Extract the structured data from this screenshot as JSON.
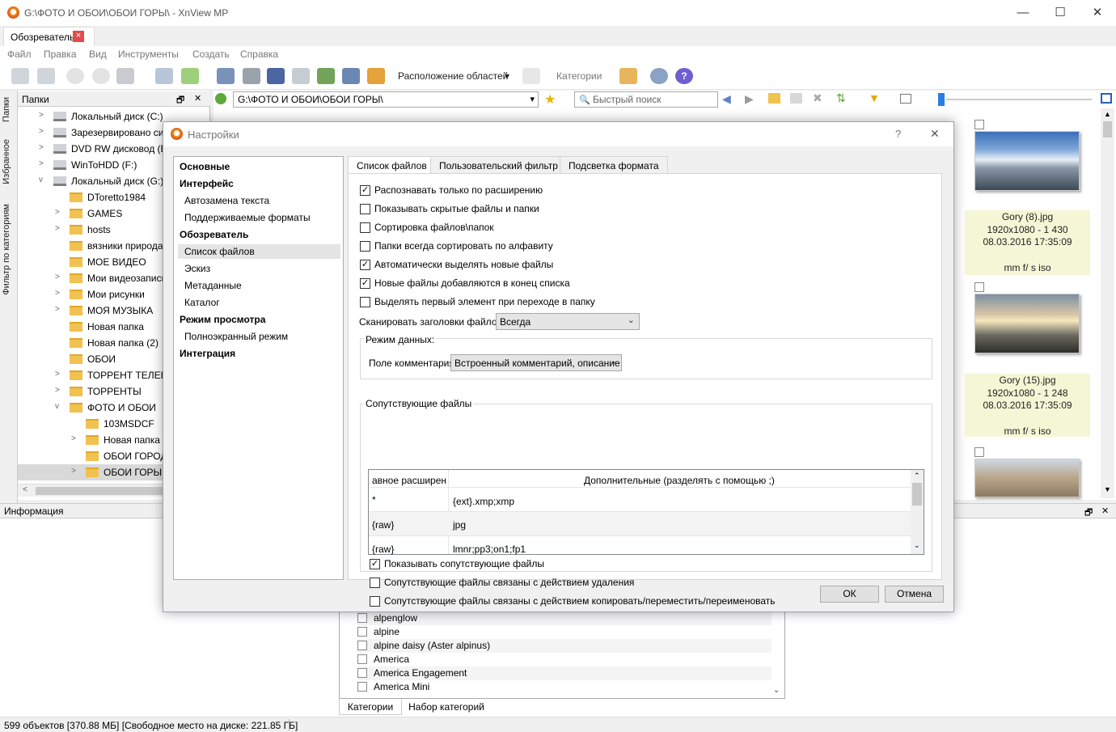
{
  "window": {
    "title": "G:\\ФОТО И ОБОИ\\ОБОИ ГОРЫ\\ - XnView MP",
    "min": "—",
    "max": "☐",
    "close": "✕"
  },
  "tab": {
    "label": "Обозреватель",
    "close": "×"
  },
  "menu": [
    "Файл",
    "Правка",
    "Вид",
    "Инструменты",
    "Создать",
    "Справка"
  ],
  "toolbar": {
    "layout_label": "Расположение областей",
    "categories_label": "Категории"
  },
  "sidetabs": [
    "Папки",
    "Избранное",
    "Фильтр по категориям"
  ],
  "folders": {
    "header": "Папки",
    "pin": "🗗",
    "close": "✕",
    "items": [
      {
        "label": "Локальный диск (C:)",
        "kind": "drive",
        "arrow": ">"
      },
      {
        "label": "Зарезервировано си",
        "kind": "drive",
        "arrow": ">"
      },
      {
        "label": "DVD RW дисковод (E:",
        "kind": "drive",
        "arrow": ">"
      },
      {
        "label": "WinToHDD (F:)",
        "kind": "drive",
        "arrow": ">"
      },
      {
        "label": "Локальный диск (G:)",
        "kind": "drive",
        "arrow": "v"
      },
      {
        "label": "DToretto1984",
        "kind": "folder",
        "arrow": ""
      },
      {
        "label": "GAMES",
        "kind": "folder",
        "arrow": ">"
      },
      {
        "label": "hosts",
        "kind": "folder",
        "arrow": ">"
      },
      {
        "label": "вязники природа",
        "kind": "folder",
        "arrow": ""
      },
      {
        "label": "МОЕ ВИДЕО",
        "kind": "folder",
        "arrow": ""
      },
      {
        "label": "Мои видеозаписи",
        "kind": "folder",
        "arrow": ">"
      },
      {
        "label": "Мои рисунки",
        "kind": "folder",
        "arrow": ">"
      },
      {
        "label": "МОЯ МУЗЫКА",
        "kind": "folder",
        "arrow": ">"
      },
      {
        "label": "Новая папка",
        "kind": "folder",
        "arrow": ""
      },
      {
        "label": "Новая папка (2)",
        "kind": "folder",
        "arrow": ""
      },
      {
        "label": "ОБОИ",
        "kind": "folder",
        "arrow": ""
      },
      {
        "label": "ТОРРЕНТ ТЕЛЕВИ",
        "kind": "folder",
        "arrow": ">"
      },
      {
        "label": "ТОРРЕНТЫ",
        "kind": "folder",
        "arrow": ">"
      },
      {
        "label": "ФОТО И ОБОИ",
        "kind": "folder",
        "arrow": "v"
      },
      {
        "label": "103MSDCF",
        "kind": "folder",
        "arrow": "",
        "indent": 1
      },
      {
        "label": "Новая папка",
        "kind": "folder",
        "arrow": ">",
        "indent": 1
      },
      {
        "label": "ОБОИ ГОРОД",
        "kind": "folder",
        "arrow": "",
        "indent": 1
      },
      {
        "label": "ОБОИ ГОРЫ",
        "kind": "folder",
        "arrow": ">",
        "indent": 1,
        "selected": true
      }
    ]
  },
  "address": {
    "path": "G:\\ФОТО И ОБОИ\\ОБОИ ГОРЫ\\",
    "search_placeholder": "Быстрый поиск"
  },
  "thumbs": [
    {
      "name": "Gory (8).jpg",
      "dims": "1920x1080 - 1 430",
      "date": "08.03.2016 17:35:09",
      "exif": "mm f/ s iso"
    },
    {
      "name": "Gory (15).jpg",
      "dims": "1920x1080 - 1 248",
      "date": "08.03.2016 17:35:09",
      "exif": "mm f/ s iso"
    }
  ],
  "info": {
    "header": "Информация",
    "pin": "🗗",
    "close": "✕"
  },
  "categories": {
    "items": [
      "alpenglow",
      "alpine",
      "alpine daisy (Aster alpinus)",
      "America",
      "America Engagement",
      "America Mini"
    ],
    "tabs": [
      "Категории",
      "Набор категорий"
    ]
  },
  "status": "599 объектов [370.88 МБ] [Свободное место на диске: 221.85 ГБ]",
  "dialog": {
    "title": "Настройки",
    "help": "?",
    "close": "✕",
    "nav": [
      {
        "label": "Основные",
        "bold": true
      },
      {
        "label": "Интерфейс",
        "bold": true
      },
      {
        "label": "Автозамена текста"
      },
      {
        "label": "Поддерживаемые форматы"
      },
      {
        "label": "Обозреватель",
        "bold": true
      },
      {
        "label": "Список файлов",
        "selected": true
      },
      {
        "label": "Эскиз"
      },
      {
        "label": "Метаданные"
      },
      {
        "label": "Каталог"
      },
      {
        "label": "Режим просмотра",
        "bold": true
      },
      {
        "label": "Полноэкранный режим"
      },
      {
        "label": "Интеграция",
        "bold": true
      }
    ],
    "tabs": [
      "Список файлов",
      "Пользовательский фильтр",
      "Подсветка формата"
    ],
    "options": [
      {
        "label": "Распознавать только по расширению",
        "checked": true
      },
      {
        "label": "Показывать скрытые файлы и папки",
        "checked": false
      },
      {
        "label": "Сортировка файлов\\папок",
        "checked": false
      },
      {
        "label": "Папки всегда сортировать по алфавиту",
        "checked": false
      },
      {
        "label": "Автоматически выделять новые файлы",
        "checked": true
      },
      {
        "label": "Новые файлы добавляются в конец списка",
        "checked": true
      },
      {
        "label": "Выделять первый элемент при переходе в папку",
        "checked": false
      }
    ],
    "scan_label": "Сканировать заголовки файлов",
    "scan_value": "Всегда",
    "data_mode_label": "Режим данных:",
    "comment_label": "Поле комментария",
    "comment_value": "Встроенный комментарий, описание",
    "assoc_group": "Сопутствующие файлы",
    "assoc_headers": [
      "авное расширен",
      "Дополнительные (разделять с помощью ;)"
    ],
    "assoc_rows": [
      [
        "*",
        "{ext}.xmp;xmp"
      ],
      [
        "{raw}",
        "jpg"
      ],
      [
        "{raw}",
        "lmnr;pp3;on1;fp1"
      ]
    ],
    "assoc_options": [
      {
        "label": "Показывать сопутствующие файлы",
        "checked": true
      },
      {
        "label": "Сопутствующие файлы связаны с действием удаления",
        "checked": false
      },
      {
        "label": "Сопутствующие файлы связаны с действием копировать/переместить/переименовать",
        "checked": false
      }
    ],
    "ok": "ОК",
    "cancel": "Отмена"
  }
}
